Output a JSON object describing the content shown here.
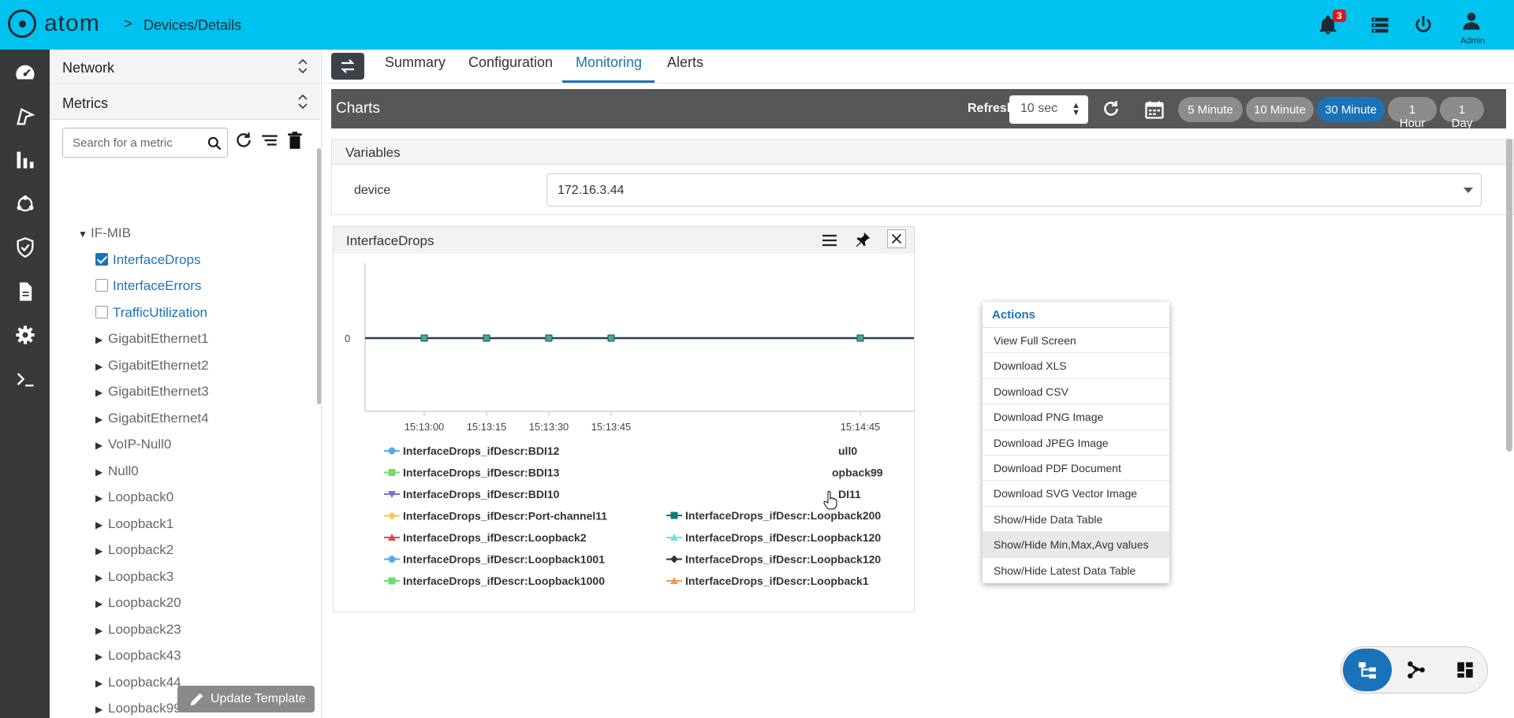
{
  "header": {
    "brand": "atom",
    "breadcrumb_sep": ">",
    "breadcrumb": "Devices/Details",
    "notifications_count": "3",
    "user_label": "Admin"
  },
  "sidebar": {
    "sections": [
      {
        "label": "Network"
      },
      {
        "label": "Metrics"
      }
    ],
    "search_placeholder": "Search for a metric",
    "tree": {
      "root": "IF-MIB",
      "metrics": [
        {
          "label": "InterfaceDrops",
          "checked": true
        },
        {
          "label": "InterfaceErrors",
          "checked": false
        },
        {
          "label": "TrafficUtilization",
          "checked": false
        }
      ],
      "interfaces": [
        "GigabitEthernet1",
        "GigabitEthernet2",
        "GigabitEthernet3",
        "GigabitEthernet4",
        "VoIP-Null0",
        "Null0",
        "Loopback0",
        "Loopback1",
        "Loopback2",
        "Loopback3",
        "Loopback20",
        "Loopback23",
        "Loopback43",
        "Loopback44",
        "Loopback99"
      ]
    },
    "update_template_label": "Update Template"
  },
  "tabs": [
    {
      "label": "Summary",
      "active": false
    },
    {
      "label": "Configuration",
      "active": false
    },
    {
      "label": "Monitoring",
      "active": true
    },
    {
      "label": "Alerts",
      "active": false
    }
  ],
  "charts_bar": {
    "title": "Charts",
    "refresh_label": "Refresh",
    "refresh_value": "10 sec",
    "ranges": [
      {
        "label": "5 Minute",
        "active": false
      },
      {
        "label": "10 Minute",
        "active": false
      },
      {
        "label": "30 Minute",
        "active": true
      },
      {
        "label": "1 Hour",
        "active": false
      },
      {
        "label": "1 Day",
        "active": false
      }
    ]
  },
  "variables": {
    "title": "Variables",
    "device_label": "device",
    "device_value": "172.16.3.44"
  },
  "chart_panel": {
    "title": "InterfaceDrops"
  },
  "chart_data": {
    "type": "line",
    "title": "",
    "xlabel": "",
    "ylabel": "",
    "x_ticks": [
      "15:13:00",
      "15:13:15",
      "15:13:30",
      "15:13:45",
      "15:14:45"
    ],
    "y_ticks": [
      "0"
    ],
    "points_x": [
      "15:13:00",
      "15:13:15",
      "15:13:30",
      "15:13:45",
      "15:14:45"
    ],
    "values": [
      0,
      0,
      0,
      0,
      0
    ],
    "legend": [
      {
        "name": "InterfaceDrops_ifDescr:BDI12",
        "color": "#5aa9e6",
        "marker": "circle"
      },
      {
        "name": "InterfaceDrops_ifDescr:BDI13",
        "color": "#6fdc6f",
        "marker": "square"
      },
      {
        "name": "InterfaceDrops_ifDescr:BDI10",
        "color": "#7b6fd8",
        "marker": "triangle-down"
      },
      {
        "name": "InterfaceDrops_ifDescr:Port-channel11",
        "color": "#f2c94c",
        "marker": "diamond"
      },
      {
        "name": "InterfaceDrops_ifDescr:Loopback2",
        "color": "#e04848",
        "marker": "triangle"
      },
      {
        "name": "InterfaceDrops_ifDescr:Loopback1001",
        "color": "#5aa9e6",
        "marker": "circle"
      },
      {
        "name": "InterfaceDrops_ifDescr:Loopback1000",
        "color": "#6fdc6f",
        "marker": "square"
      },
      {
        "name": "ull0",
        "color": "#ffffff",
        "marker": "none"
      },
      {
        "name": "opback99",
        "color": "#ffffff",
        "marker": "none"
      },
      {
        "name": "DI11",
        "color": "#ffffff",
        "marker": "none"
      },
      {
        "name": "InterfaceDrops_ifDescr:Loopback200",
        "color": "#0d7a7a",
        "marker": "square"
      },
      {
        "name": "InterfaceDrops_ifDescr:Loopback120",
        "color": "#6fe0e0",
        "marker": "triangle"
      },
      {
        "name": "InterfaceDrops_ifDescr:Loopback120",
        "color": "#333333",
        "marker": "diamond"
      },
      {
        "name": "InterfaceDrops_ifDescr:Loopback1",
        "color": "#f39c4a",
        "marker": "triangle"
      }
    ],
    "line_color": "#2c3e50",
    "marker_color": "#4aa3a3"
  },
  "actions_menu": {
    "title": "Actions",
    "items": [
      "View Full Screen",
      "Download XLS",
      "Download CSV",
      "Download PNG Image",
      "Download JPEG Image",
      "Download PDF Document",
      "Download SVG Vector Image",
      "Show/Hide Data Table",
      "Show/Hide Min,Max,Avg values",
      "Show/Hide Latest Data Table"
    ],
    "hovered_index": 8
  }
}
